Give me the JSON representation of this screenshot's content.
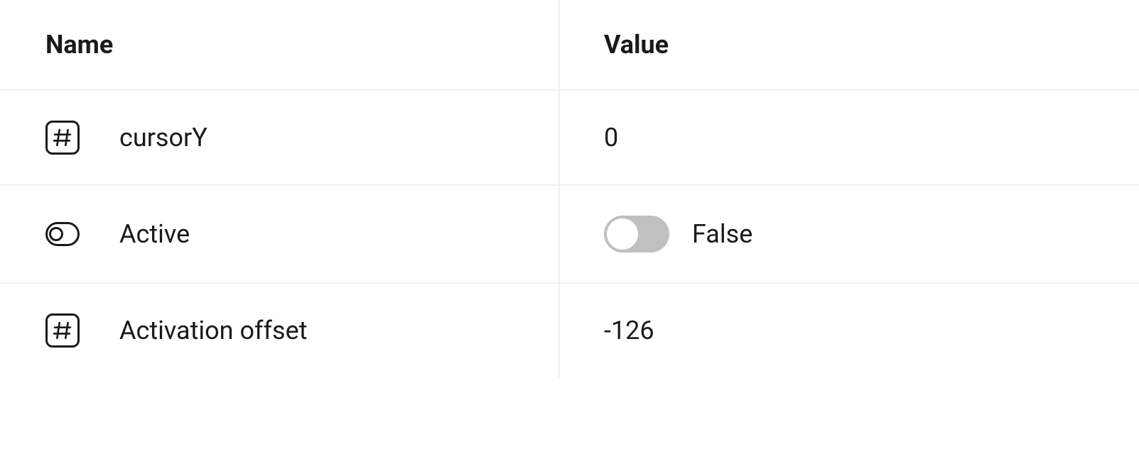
{
  "headers": {
    "name": "Name",
    "value": "Value"
  },
  "rows": [
    {
      "icon": "number-icon",
      "name": "cursorY",
      "value": "0",
      "type": "number"
    },
    {
      "icon": "toggle-icon",
      "name": "Active",
      "value": "False",
      "type": "toggle"
    },
    {
      "icon": "number-icon",
      "name": "Activation offset",
      "value": "-126",
      "type": "number"
    }
  ]
}
